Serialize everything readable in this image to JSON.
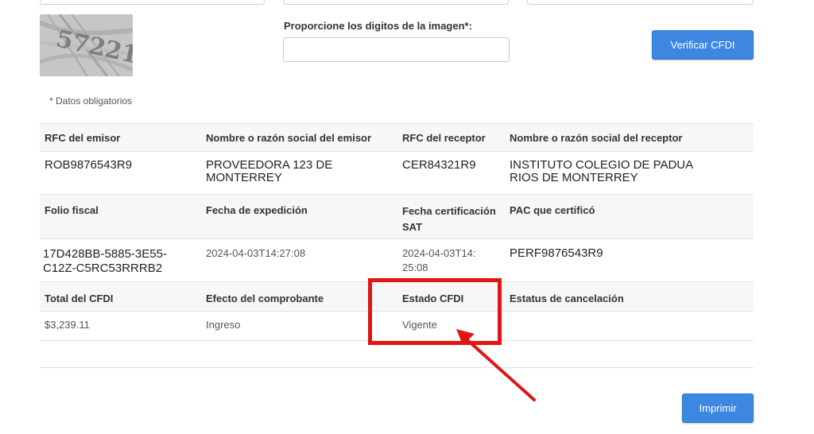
{
  "captcha": {
    "label": "Proporcione los digitos de la imagen*:",
    "image_text": "57221",
    "input_value": ""
  },
  "buttons": {
    "verify": "Verificar CFDI",
    "print": "Imprimir"
  },
  "required_note": "* Datos obligatorios",
  "result": {
    "row1": {
      "headers": [
        "RFC del emisor",
        "Nombre o razón social del emisor",
        "RFC del receptor",
        "Nombre o razón social del receptor"
      ],
      "values": [
        "ROB9876543R9",
        "PROVEEDORA 123 DE MONTERREY",
        "CER84321R9",
        "INSTITUTO COLEGIO DE PADUA RIOS DE MONTERREY"
      ]
    },
    "row2": {
      "headers": [
        "Folio fiscal",
        "Fecha de expedición",
        "Fecha certificación SAT",
        "PAC que certificó"
      ],
      "values": [
        "17D428BB-5885-3E55-C12Z-C5RC53RRRB2",
        "2024-04-03T14:27:08",
        "2024-04-03T14:25:08",
        "PERF9876543R9"
      ]
    },
    "row3": {
      "headers": [
        "Total del CFDI",
        "Efecto del comprobante",
        "Estado CFDI",
        "Estatus de cancelación"
      ],
      "values": [
        "$3,239.11",
        "Ingreso",
        "Vigente",
        ""
      ]
    }
  },
  "colors": {
    "button_bg": "#3d87e0",
    "highlight": "#e01515"
  }
}
